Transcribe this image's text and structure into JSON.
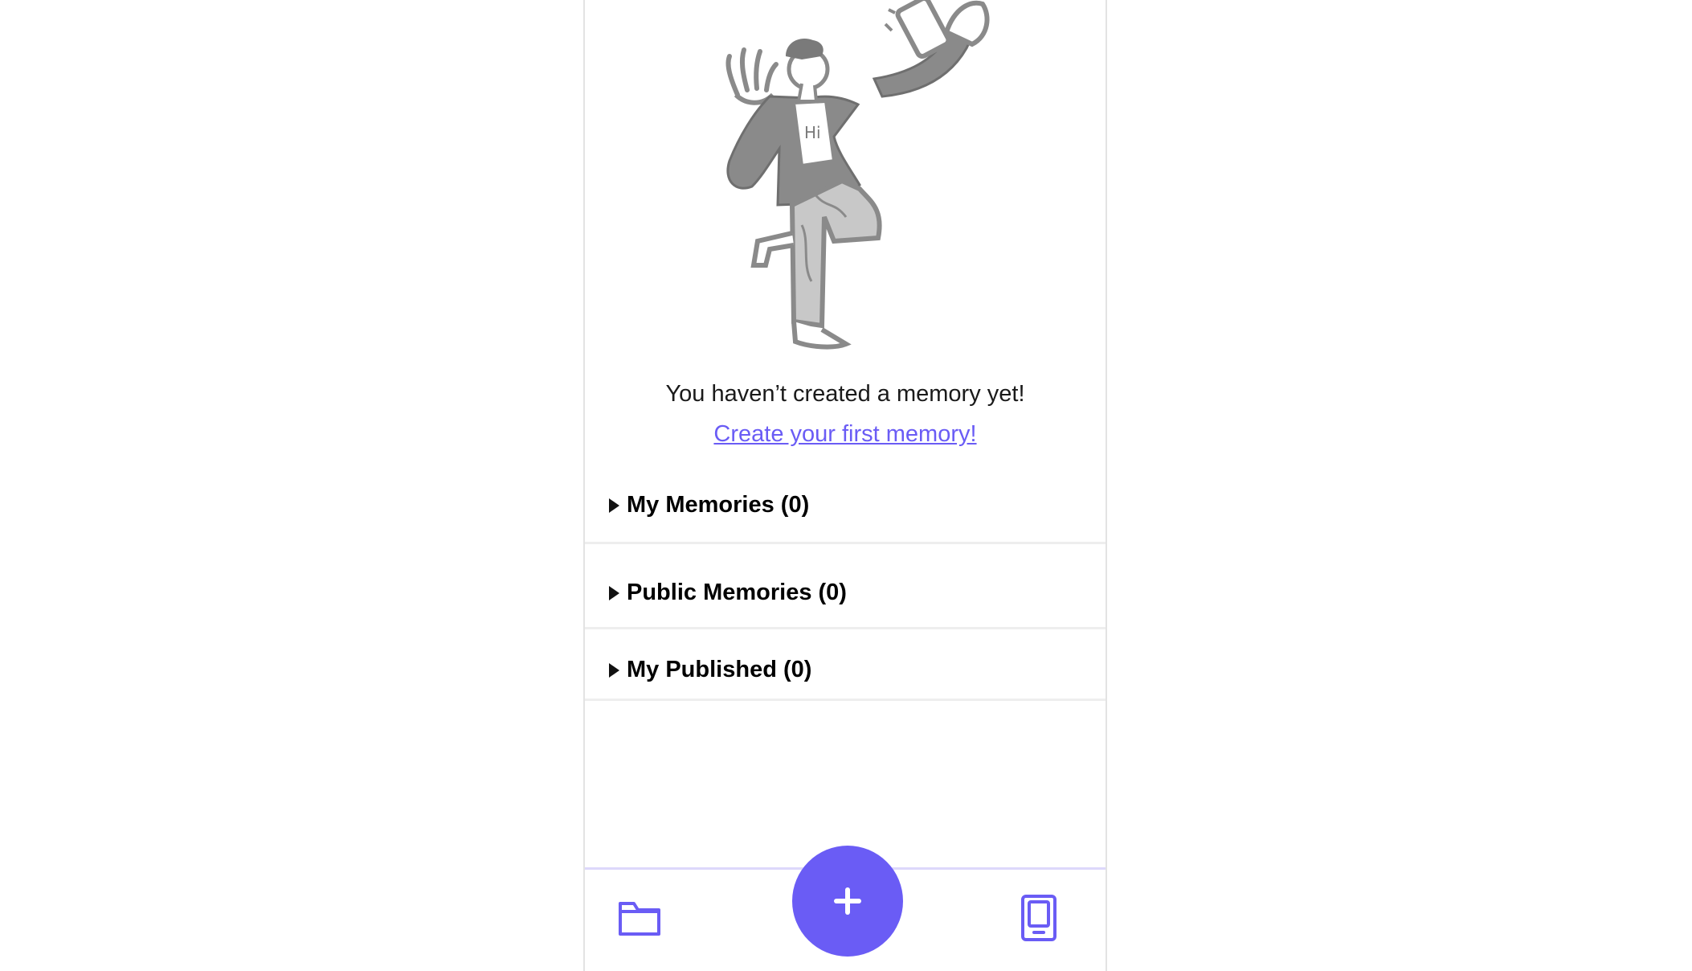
{
  "empty_state": {
    "message": "You haven’t created a memory yet!",
    "cta_link": "Create your first memory!",
    "illustration_text": "Hi"
  },
  "sections": [
    {
      "label": "My Memories (0)",
      "expanded": false
    },
    {
      "label": "Public Memories (0)",
      "expanded": false
    },
    {
      "label": "My Published (0)",
      "expanded": false
    }
  ],
  "bottom_nav": {
    "left_icon": "folder-icon",
    "center_icon": "plus-icon",
    "right_icon": "tablet-icon"
  },
  "colors": {
    "accent": "#6a5cf5",
    "text": "#1a1a1a",
    "illustration_gray": "#8a8a8a"
  }
}
